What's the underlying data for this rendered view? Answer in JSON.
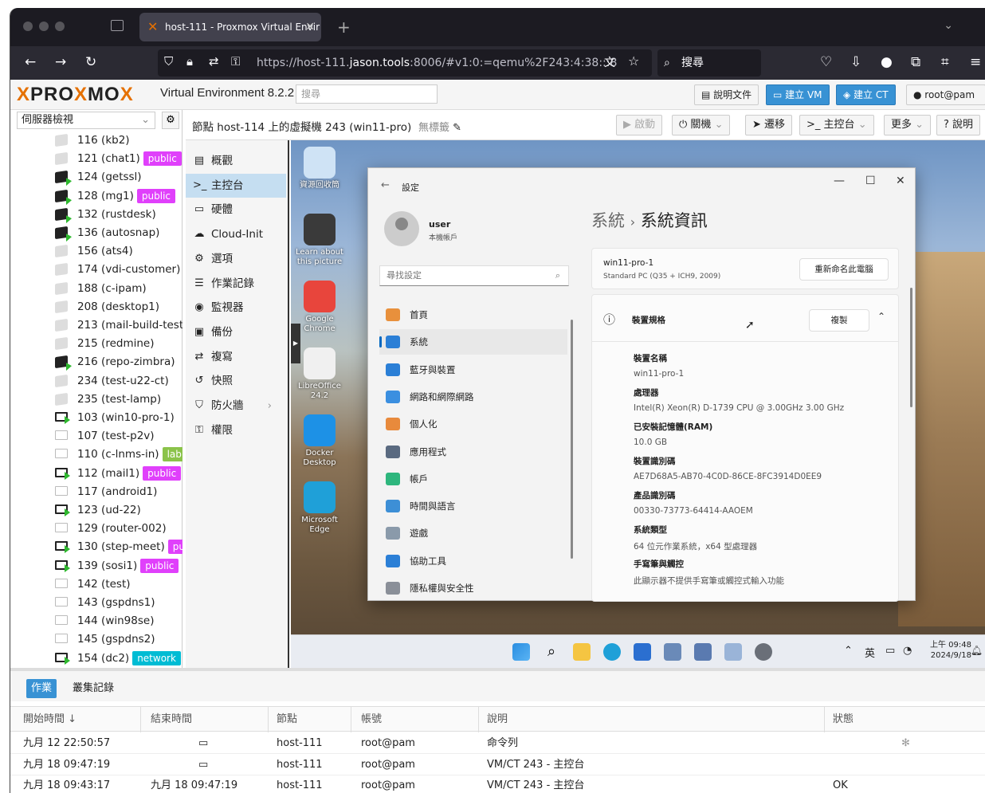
{
  "browser": {
    "tab_title": "host-111 - Proxmox Virtual Envir",
    "url_prefix": "https://host-111.",
    "url_domain": "jason.tools",
    "url_rest": ":8006/#v1:0:=qemu%2F243:4:38:::8",
    "search_label": "搜尋"
  },
  "header": {
    "logo_a": "PRO",
    "logo_x": "X",
    "logo_b": "MO",
    "logo_x2": "X",
    "product": "Virtual Environment 8.2.2",
    "search_placeholder": "搜尋",
    "docs_label": "說明文件",
    "create_vm_label": "建立 VM",
    "create_ct_label": "建立 CT",
    "user_label": "root@pam"
  },
  "tree": {
    "view_label": "伺服器檢視",
    "items": [
      {
        "label": "116 (kb2)",
        "type": "ct-off"
      },
      {
        "label": "121 (chat1)",
        "type": "ct-off",
        "tag": "public",
        "tag_color": "#e040fb"
      },
      {
        "label": "124 (getssl)",
        "type": "ct-on"
      },
      {
        "label": "128 (mg1)",
        "type": "ct-on",
        "tag": "public",
        "tag_color": "#e040fb"
      },
      {
        "label": "132 (rustdesk)",
        "type": "ct-on"
      },
      {
        "label": "136 (autosnap)",
        "type": "ct-on"
      },
      {
        "label": "156 (ats4)",
        "type": "ct-off"
      },
      {
        "label": "174 (vdi-customer)",
        "type": "ct-off"
      },
      {
        "label": "188 (c-ipam)",
        "type": "ct-off"
      },
      {
        "label": "208 (desktop1)",
        "type": "ct-off"
      },
      {
        "label": "213 (mail-build-test)",
        "type": "ct-off"
      },
      {
        "label": "215 (redmine)",
        "type": "ct-off"
      },
      {
        "label": "216 (repo-zimbra)",
        "type": "ct-on"
      },
      {
        "label": "234 (test-u22-ct)",
        "type": "ct-off"
      },
      {
        "label": "235 (test-lamp)",
        "type": "ct-off"
      },
      {
        "label": "103 (win10-pro-1)",
        "type": "vm-on"
      },
      {
        "label": "107 (test-p2v)",
        "type": "vm-off"
      },
      {
        "label": "110 (c-lnms-in)",
        "type": "vm-off",
        "tag": "lab",
        "tag_color": "#8bc34a"
      },
      {
        "label": "112 (mail1)",
        "type": "vm-on",
        "tag": "public",
        "tag_color": "#e040fb"
      },
      {
        "label": "117 (android1)",
        "type": "vm-off"
      },
      {
        "label": "123 (ud-22)",
        "type": "vm-on"
      },
      {
        "label": "129 (router-002)",
        "type": "vm-off"
      },
      {
        "label": "130 (step-meet)",
        "type": "vm-on",
        "tag": "pul",
        "tag_color": "#e040fb"
      },
      {
        "label": "139 (sosi1)",
        "type": "vm-on",
        "tag": "public",
        "tag_color": "#e040fb"
      },
      {
        "label": "142 (test)",
        "type": "vm-off"
      },
      {
        "label": "143 (gspdns1)",
        "type": "vm-off"
      },
      {
        "label": "144 (win98se)",
        "type": "vm-off"
      },
      {
        "label": "145 (gspdns2)",
        "type": "vm-off"
      },
      {
        "label": "154 (dc2)",
        "type": "vm-on",
        "tag": "network",
        "tag_color": "#00bcd4"
      }
    ]
  },
  "toolbar": {
    "title": "節點 host-114 上的虛擬機 243 (win11-pro)",
    "notag": "無標籤",
    "start": "啟動",
    "shutdown": "關機",
    "migrate": "遷移",
    "console": "主控台",
    "more": "更多",
    "help": "說明"
  },
  "side_menu": [
    {
      "label": "概觀",
      "icon": "book-icon",
      "glyph": "▤"
    },
    {
      "label": "主控台",
      "icon": "terminal-icon",
      "glyph": ">_",
      "selected": true
    },
    {
      "label": "硬體",
      "icon": "monitor-icon",
      "glyph": "▭"
    },
    {
      "label": "Cloud-Init",
      "icon": "cloud-icon",
      "glyph": "☁"
    },
    {
      "label": "選項",
      "icon": "gear-icon",
      "glyph": "⚙"
    },
    {
      "label": "作業記錄",
      "icon": "list-icon",
      "glyph": "☰"
    },
    {
      "label": "監視器",
      "icon": "eye-icon",
      "glyph": "◉"
    },
    {
      "label": "備份",
      "icon": "save-icon",
      "glyph": "▣"
    },
    {
      "label": "複寫",
      "icon": "retweet-icon",
      "glyph": "⇄"
    },
    {
      "label": "快照",
      "icon": "history-icon",
      "glyph": "↺"
    },
    {
      "label": "防火牆",
      "icon": "shield-icon",
      "glyph": "⛉"
    },
    {
      "label": "權限",
      "icon": "unlock-icon",
      "glyph": "⚿"
    }
  ],
  "desktop": {
    "icons": [
      {
        "label": "資源回收筒",
        "color": "#cfe3f5"
      },
      {
        "label": "Learn about this picture",
        "color": "#3a3a3a"
      },
      {
        "label": "Google Chrome",
        "color": "#e8453c"
      },
      {
        "label": "LibreOffice 24.2",
        "color": "#f0f0f0"
      },
      {
        "label": "Docker Desktop",
        "color": "#1d91e6"
      },
      {
        "label": "Microsoft Edge",
        "color": "#1fa0d8"
      }
    ]
  },
  "settings": {
    "window_title": "設定",
    "user_name": "user",
    "user_type": "本機帳戶",
    "find_placeholder": "尋找設定",
    "nav": [
      {
        "label": "首頁",
        "color": "#e8903c"
      },
      {
        "label": "系統",
        "color": "#2b7fd6",
        "selected": true
      },
      {
        "label": "藍牙與裝置",
        "color": "#2b7fd6"
      },
      {
        "label": "網路和網際網路",
        "color": "#3b8fe0"
      },
      {
        "label": "個人化",
        "color": "#e88a3c"
      },
      {
        "label": "應用程式",
        "color": "#5a6a80"
      },
      {
        "label": "帳戶",
        "color": "#2eb67d"
      },
      {
        "label": "時間與語言",
        "color": "#3d8fd6"
      },
      {
        "label": "遊戲",
        "color": "#8a9aaa"
      },
      {
        "label": "協助工具",
        "color": "#2b7fd6"
      },
      {
        "label": "隱私權與安全性",
        "color": "#8a8f98"
      }
    ],
    "breadcrumb_parent": "系統",
    "breadcrumb_sep": "›",
    "breadcrumb_current": "系統資訊",
    "pc_name": "win11-pro-1",
    "pc_model": "Standard PC (Q35 + ICH9, 2009)",
    "rename_btn": "重新命名此電腦",
    "spec_title": "裝置規格",
    "copy_btn": "複製",
    "specs": [
      {
        "k": "裝置名稱",
        "v": "win11-pro-1"
      },
      {
        "k": "處理器",
        "v": "Intel(R) Xeon(R) D-1739 CPU @ 3.00GHz   3.00 GHz"
      },
      {
        "k": "已安裝記憶體(RAM)",
        "v": "10.0 GB"
      },
      {
        "k": "裝置識別碼",
        "v": "AE7D68A5-AB70-4C0D-86CE-8FC3914D0EE9"
      },
      {
        "k": "產品識別碼",
        "v": "00330-73773-64414-AAOEM"
      },
      {
        "k": "系統類型",
        "v": "64 位元作業系統，x64 型處理器"
      },
      {
        "k": "手寫筆與觸控",
        "v": "此顯示器不提供手寫筆或觸控式輸入功能"
      }
    ]
  },
  "taskbar": {
    "lang": "英",
    "time": "上午 09:48",
    "date": "2024/9/18"
  },
  "bottom": {
    "tabs": [
      "作業",
      "叢集記錄"
    ],
    "columns": [
      "開始時間 ↓",
      "結束時間",
      "節點",
      "帳號",
      "說明",
      "狀態"
    ],
    "rows": [
      {
        "start": "九月 12 22:50:57",
        "end": "",
        "node": "host-111",
        "user": "root@pam",
        "desc": "命令列",
        "status": ""
      },
      {
        "start": "九月 18 09:47:19",
        "end": "",
        "node": "host-111",
        "user": "root@pam",
        "desc": "VM/CT 243 - 主控台",
        "status": ""
      },
      {
        "start": "九月 18 09:43:17",
        "end": "九月 18 09:47:19",
        "node": "host-111",
        "user": "root@pam",
        "desc": "VM/CT 243 - 主控台",
        "status": "OK"
      }
    ]
  }
}
